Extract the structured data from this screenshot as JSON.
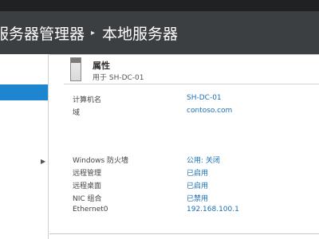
{
  "title_bar": {
    "path_left": "服务器管理器",
    "separator": "▸",
    "path_right": "本地服务器"
  },
  "properties": {
    "heading": "属性",
    "subtitle": "用于 SH-DC-01",
    "rows": [
      {
        "label": "计算机名",
        "value": "SH-DC-01"
      },
      {
        "label": "域",
        "value": "contoso.com"
      },
      {
        "label": "Windows 防火墙",
        "value": "公用: 关闭"
      },
      {
        "label": "远程管理",
        "value": "已启用"
      },
      {
        "label": "远程桌面",
        "value": "已启用"
      },
      {
        "label": "NIC 组合",
        "value": "已禁用"
      },
      {
        "label": "Ethernet0",
        "value": "192.168.100.1"
      }
    ]
  },
  "icons": {
    "server": "server-icon",
    "expand": "chevron-right-icon"
  },
  "colors": {
    "title_bar_bg": "#3c3f42",
    "selection": "#1e86d0",
    "link": "#1a6fb7"
  }
}
